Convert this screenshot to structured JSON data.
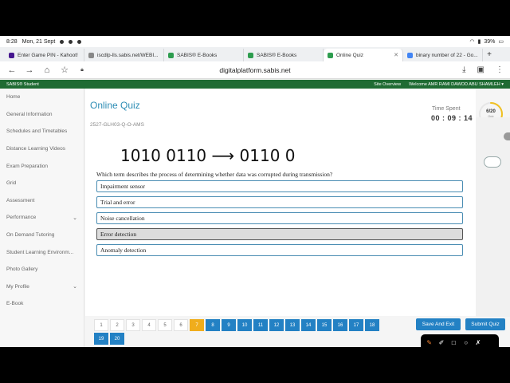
{
  "status": {
    "time": "8:28",
    "date": "Mon, 21 Sept",
    "battery": "39%"
  },
  "tabs": [
    {
      "title": "Enter Game PIN - Kahoot!",
      "fav_color": "#46178f"
    },
    {
      "title": "iscdlp-lls.sabis.net/WEBI...",
      "fav_color": "#888888"
    },
    {
      "title": "SABIS® E-Books",
      "fav_color": "#2e9d4f"
    },
    {
      "title": "SABIS® E-Books",
      "fav_color": "#2e9d4f"
    },
    {
      "title": "Online Quiz",
      "fav_color": "#2e9d4f"
    },
    {
      "title": "binary number of 22 - Go...",
      "fav_color": "#4285f4"
    }
  ],
  "address": {
    "url": "digitalplatform.sabis.net"
  },
  "site": {
    "brand": "SABIS® Student",
    "overview": "Site Overview",
    "welcome": "Welcome AMR RAMI DAWOD ABU SHAMLEH ▾"
  },
  "sidebar": {
    "items": [
      {
        "label": "Home",
        "chevron": false
      },
      {
        "label": "General Information",
        "chevron": false
      },
      {
        "label": "Schedules and Timetables",
        "chevron": false
      },
      {
        "label": "Distance Learning Videos",
        "chevron": false
      },
      {
        "label": "Exam Preparation",
        "chevron": false
      },
      {
        "label": "Grid",
        "chevron": false
      },
      {
        "label": "Assessment",
        "chevron": false
      },
      {
        "label": "Performance",
        "chevron": true
      },
      {
        "label": "On Demand Tutoring",
        "chevron": false
      },
      {
        "label": "Student Learning Environm...",
        "chevron": false
      },
      {
        "label": "Photo Gallery",
        "chevron": false
      },
      {
        "label": "My Profile",
        "chevron": true
      },
      {
        "label": "E-Book",
        "chevron": false
      }
    ]
  },
  "quiz": {
    "title": "Online Quiz",
    "code": "2527-GLH03-Q-O-AMS",
    "time_label": "Time Spent",
    "time_value": "00 : 09 : 14",
    "progress": {
      "count": "6/20",
      "label1": "Quiz",
      "label2": "Progress",
      "fraction": 0.3
    },
    "handwriting": "1010 0110 ⟶ 0110 0",
    "question": "Which term describes the process of determining whether data was corrupted during transmission?",
    "options": [
      {
        "label": "Impairment sensor",
        "selected": false
      },
      {
        "label": "Trial and error",
        "selected": false
      },
      {
        "label": "Noise cancellation",
        "selected": false
      },
      {
        "label": "Error detection",
        "selected": true
      },
      {
        "label": "Anomaly detection",
        "selected": false
      }
    ]
  },
  "pagination": {
    "pages": [
      "1",
      "2",
      "3",
      "4",
      "5",
      "6",
      "7",
      "8",
      "9",
      "10",
      "11",
      "12",
      "13",
      "14",
      "15",
      "16",
      "17",
      "18",
      "19",
      "20"
    ],
    "current": "7",
    "done": [
      "8",
      "9",
      "10",
      "11",
      "12",
      "13",
      "14",
      "15",
      "16",
      "17",
      "18",
      "19",
      "20"
    ]
  },
  "actions": {
    "save": "Save And Exit",
    "submit": "Submit Quiz"
  },
  "colors": {
    "accent": "#2381c4",
    "header": "#1f6b33",
    "current_page": "#f0ad1c"
  }
}
